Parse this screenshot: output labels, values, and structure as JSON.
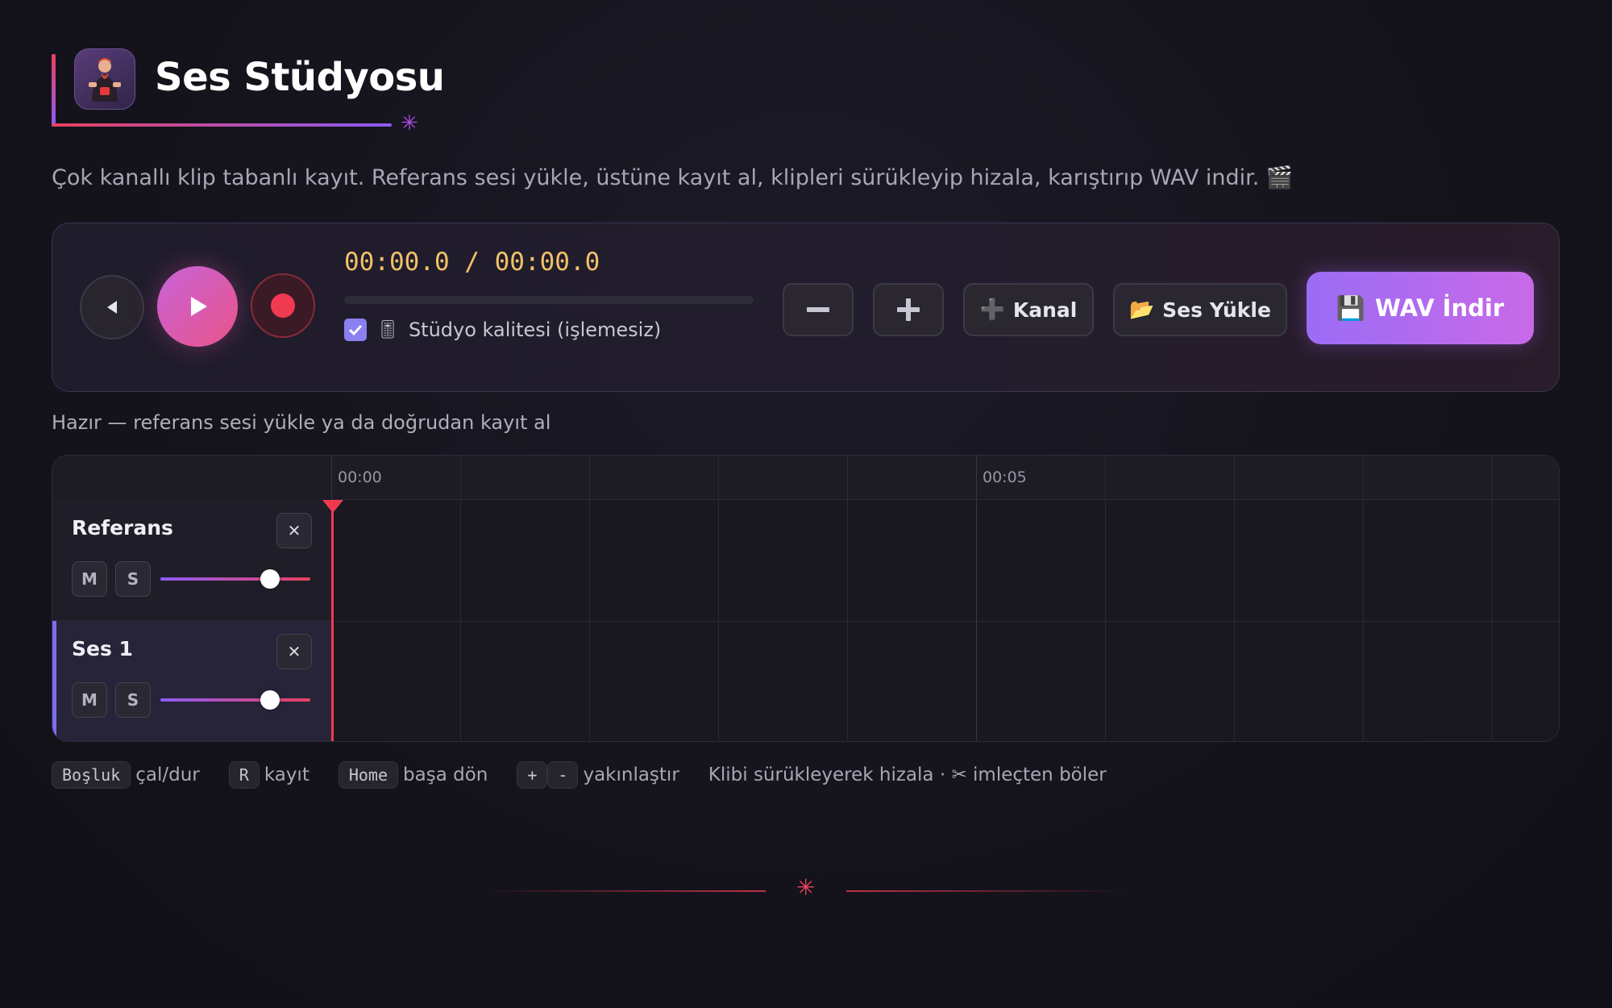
{
  "app": {
    "title": "Ses Stüdyosu",
    "subtitle": "Çok kanallı klip tabanlı kayıt. Referans sesi yükle, üstüne kayıt al, klipleri sürükleyip hizala, karıştırıp WAV indir. 🎬"
  },
  "transport": {
    "time_display": "00:00.0 / 00:00.0",
    "progress": 0,
    "quality_checked": true,
    "quality_icon": "🎚",
    "quality_label": "Stüdyo kalitesi (işlemesiz)",
    "zoom_out_label": "−",
    "zoom_in_label": "+",
    "add_channel_icon": "➕",
    "add_channel_label": "Kanal",
    "load_audio_icon": "📂",
    "load_audio_label": "Ses Yükle",
    "download_icon": "💾",
    "download_label": "WAV İndir"
  },
  "status": "Hazır — referans sesi yükle ya da doğrudan kayıt al",
  "timeline": {
    "ruler_labels": [
      "00:00",
      "00:05"
    ],
    "tracks": [
      {
        "name": "Referans",
        "mute": "M",
        "solo": "S",
        "delete": "✕",
        "volume": 0.73,
        "active": false
      },
      {
        "name": "Ses 1",
        "mute": "M",
        "solo": "S",
        "delete": "✕",
        "volume": 0.73,
        "active": true
      }
    ]
  },
  "shortcuts": [
    {
      "keys": [
        "Boşluk"
      ],
      "text": "çal/dur"
    },
    {
      "keys": [
        "R"
      ],
      "text": "kayıt"
    },
    {
      "keys": [
        "Home"
      ],
      "text": "başa dön"
    },
    {
      "keys": [
        "+",
        "-"
      ],
      "text": "yakınlaştır"
    }
  ],
  "tip": "Klibi sürükleyerek hizala · ✂ imleçten böler",
  "colors": {
    "accent": "#8b5cf6",
    "record": "#f03a50",
    "time": "#f0c267",
    "play_gradient_start": "#c863d8",
    "play_gradient_end": "#e9548a"
  }
}
